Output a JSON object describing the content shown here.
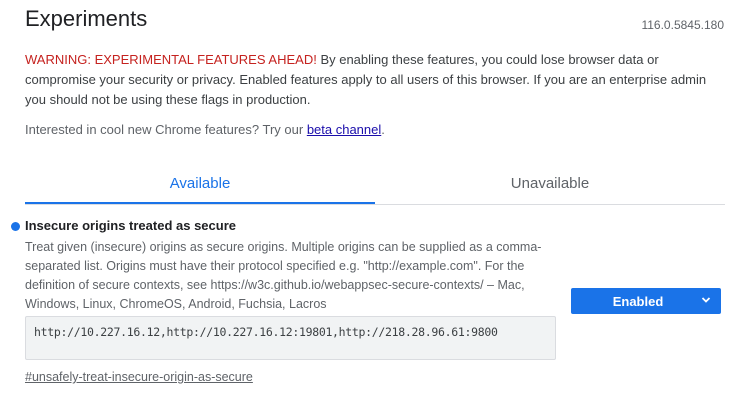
{
  "page": {
    "title": "Experiments",
    "version": "116.0.5845.180"
  },
  "warning": {
    "prefix": "WARNING: EXPERIMENTAL FEATURES AHEAD!",
    "text": " By enabling these features, you could lose browser data or compromise your security or privacy. Enabled features apply to all users of this browser. If you are an enterprise admin you should not be using these flags in production."
  },
  "interest": {
    "text": "Interested in cool new Chrome features? Try our ",
    "link": "beta channel",
    "suffix": "."
  },
  "tabs": [
    {
      "label": "Available",
      "selected": true
    },
    {
      "label": "Unavailable",
      "selected": false
    }
  ],
  "feature": {
    "name": "Insecure origins treated as secure",
    "description": "Treat given (insecure) origins as secure origins. Multiple origins can be supplied as a comma-separated list. Origins must have their protocol specified e.g. \"http://example.com\". For the definition of secure contexts, see https://w3c.github.io/webappsec-secure-contexts/ – Mac, Windows, Linux, ChromeOS, Android, Fuchsia, Lacros",
    "value": "http://10.227.16.12,http://10.227.16.12:19801,http://218.28.96.61:9800",
    "state": "Enabled",
    "flag": "#unsafely-treat-insecure-origin-as-secure"
  },
  "colors": {
    "accent": "#1a73e8",
    "warning": "#c5221f"
  }
}
